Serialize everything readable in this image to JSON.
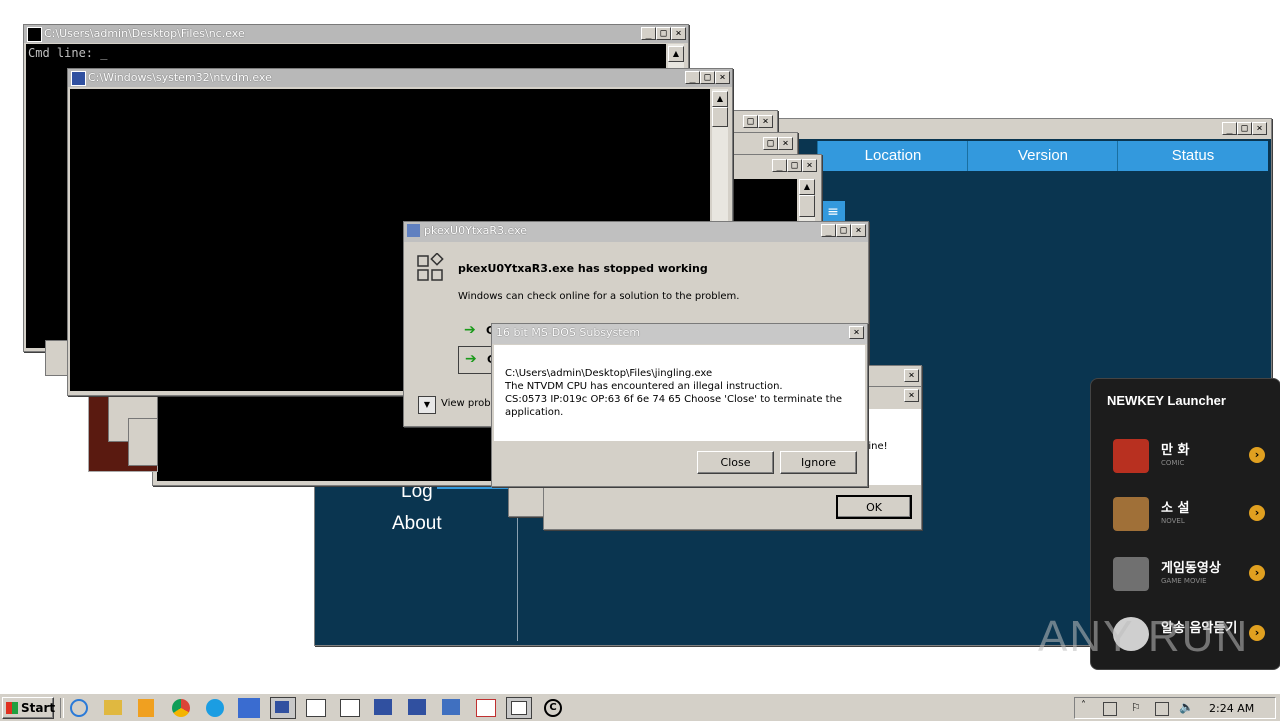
{
  "windows": {
    "nc": {
      "title": "C:\\Users\\admin\\Desktop\\Files\\nc.exe",
      "prompt": "Cmd line: _"
    },
    "ntvdm": {
      "title": "C:\\Windows\\system32\\ntvdm.exe"
    },
    "crash": {
      "title": "pkexU0YtxaR3.exe",
      "heading": "pkexU0YtxaR3.exe has stopped working",
      "message": "Windows can check online for a solution to the problem.",
      "option1_char": "C",
      "option2_char": "C",
      "view_label": "View probl"
    },
    "msdos": {
      "title": "16 bit MS-DOS Subsystem",
      "line1": "C:\\Users\\admin\\Desktop\\Files\\jingling.exe",
      "line2": "The NTVDM CPU has encountered an illegal instruction.",
      "line3": "CS:0573 IP:019c OP:63 6f 6e 74 65 Choose 'Close' to terminate the",
      "line4": "application.",
      "close_label": "Close",
      "ignore_label": "Ignore"
    },
    "ok_dialog": {
      "partial_text": "nine!",
      "ok_label": "OK"
    }
  },
  "app": {
    "columns": [
      "Location",
      "Version",
      "Status"
    ],
    "menu": [
      "Log",
      "About"
    ],
    "colors": {
      "background": "#0a3550",
      "header": "#3399dd"
    }
  },
  "launcher": {
    "title": "NEWKEY Launcher",
    "items": [
      {
        "label": "만 화",
        "sub": "COMIC",
        "icon": "comic-icon"
      },
      {
        "label": "소 설",
        "sub": "NOVEL",
        "icon": "book-icon"
      },
      {
        "label": "게임동영상",
        "sub": "GAME MOVIE",
        "icon": "gamepad-icon"
      },
      {
        "label": "알송 음악듣기",
        "sub": "",
        "icon": "music-icon"
      }
    ]
  },
  "watermark": "ANY RUN",
  "taskbar": {
    "start_label": "Start",
    "clock": "2:24 AM",
    "apps": [
      "ie-icon",
      "explorer-icon",
      "media-player-icon",
      "chrome-icon",
      "edge-icon",
      "app-icon",
      "app-icon",
      "console-icon",
      "console-icon",
      "ntvdm-icon",
      "ntvdm-icon",
      "crash-icon",
      "dos-icon",
      "console-icon",
      "copyright-icon"
    ]
  }
}
